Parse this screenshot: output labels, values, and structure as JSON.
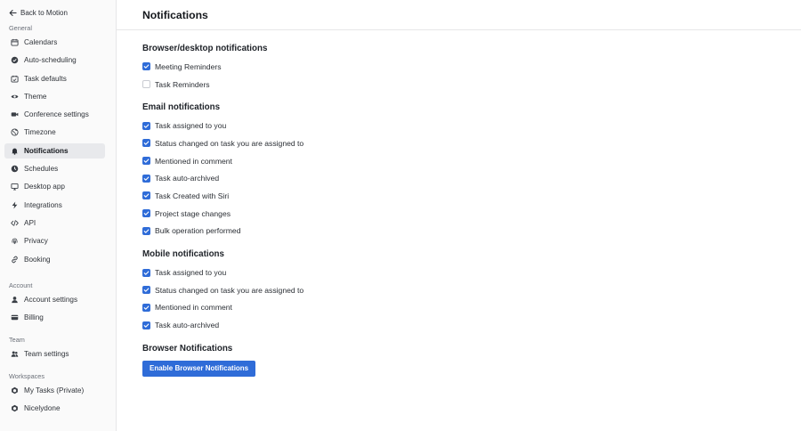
{
  "sidebar": {
    "back_label": "Back to Motion",
    "sections": [
      {
        "label": "General",
        "items": [
          {
            "label": "Calendars",
            "icon": "calendar-icon"
          },
          {
            "label": "Auto-scheduling",
            "icon": "check-circle-icon"
          },
          {
            "label": "Task defaults",
            "icon": "calendar-check-icon"
          },
          {
            "label": "Theme",
            "icon": "eye-icon"
          },
          {
            "label": "Conference settings",
            "icon": "video-icon"
          },
          {
            "label": "Timezone",
            "icon": "globe-icon"
          },
          {
            "label": "Notifications",
            "icon": "bell-icon",
            "active": true
          },
          {
            "label": "Schedules",
            "icon": "clock-icon"
          },
          {
            "label": "Desktop app",
            "icon": "desktop-icon"
          },
          {
            "label": "Integrations",
            "icon": "bolt-icon"
          },
          {
            "label": "API",
            "icon": "code-icon"
          },
          {
            "label": "Privacy",
            "icon": "fingerprint-icon"
          },
          {
            "label": "Booking",
            "icon": "link-icon"
          }
        ]
      },
      {
        "label": "Account",
        "items": [
          {
            "label": "Account settings",
            "icon": "user-icon"
          },
          {
            "label": "Billing",
            "icon": "credit-card-icon"
          }
        ]
      },
      {
        "label": "Team",
        "items": [
          {
            "label": "Team settings",
            "icon": "users-icon"
          }
        ]
      },
      {
        "label": "Workspaces",
        "items": [
          {
            "label": "My Tasks (Private)",
            "icon": "workspace-icon"
          },
          {
            "label": "Nicelydone",
            "icon": "workspace-icon"
          }
        ]
      }
    ]
  },
  "main": {
    "title": "Notifications",
    "groups": [
      {
        "title": "Browser/desktop notifications",
        "items": [
          {
            "label": "Meeting Reminders",
            "checked": true
          },
          {
            "label": "Task Reminders",
            "checked": false
          }
        ]
      },
      {
        "title": "Email notifications",
        "items": [
          {
            "label": "Task assigned to you",
            "checked": true
          },
          {
            "label": "Status changed on task you are assigned to",
            "checked": true
          },
          {
            "label": "Mentioned in comment",
            "checked": true
          },
          {
            "label": "Task auto-archived",
            "checked": true
          },
          {
            "label": "Task Created with Siri",
            "checked": true
          },
          {
            "label": "Project stage changes",
            "checked": true
          },
          {
            "label": "Bulk operation performed",
            "checked": true
          }
        ]
      },
      {
        "title": "Mobile notifications",
        "items": [
          {
            "label": "Task assigned to you",
            "checked": true
          },
          {
            "label": "Status changed on task you are assigned to",
            "checked": true
          },
          {
            "label": "Mentioned in comment",
            "checked": true
          },
          {
            "label": "Task auto-archived",
            "checked": true
          }
        ]
      }
    ],
    "browser_section": {
      "title": "Browser Notifications",
      "button_label": "Enable Browser Notifications"
    }
  },
  "colors": {
    "accent": "#2f6cd8",
    "sidebar_bg": "#fafafa",
    "active_item_bg": "#e8e9ec"
  }
}
